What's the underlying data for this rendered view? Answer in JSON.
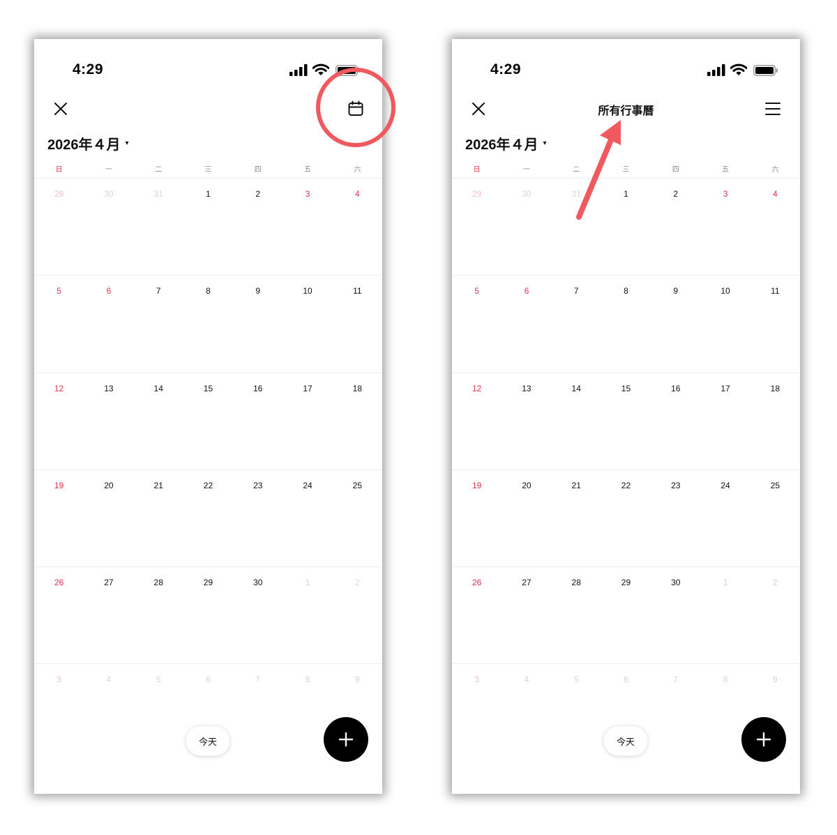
{
  "colors": {
    "accent_red": "#e0334f",
    "annotation_red": "#f05a5f",
    "fab": "#000000",
    "muted": "#d6d6d6"
  },
  "status": {
    "time": "4:29"
  },
  "header": {
    "title_right": "所有行事曆"
  },
  "month": {
    "label": "2026年４月",
    "caret": "▾"
  },
  "weekdays": [
    "日",
    "一",
    "二",
    "三",
    "四",
    "五",
    "六"
  ],
  "weeks": [
    [
      {
        "d": "29",
        "muted": true,
        "red": true
      },
      {
        "d": "30",
        "muted": true
      },
      {
        "d": "31",
        "muted": true
      },
      {
        "d": "1"
      },
      {
        "d": "2"
      },
      {
        "d": "3",
        "red": true
      },
      {
        "d": "4",
        "red": true
      }
    ],
    [
      {
        "d": "5",
        "red": true
      },
      {
        "d": "6",
        "red": true
      },
      {
        "d": "7"
      },
      {
        "d": "8"
      },
      {
        "d": "9"
      },
      {
        "d": "10"
      },
      {
        "d": "11"
      }
    ],
    [
      {
        "d": "12",
        "red": true
      },
      {
        "d": "13"
      },
      {
        "d": "14"
      },
      {
        "d": "15"
      },
      {
        "d": "16"
      },
      {
        "d": "17"
      },
      {
        "d": "18"
      }
    ],
    [
      {
        "d": "19",
        "red": true
      },
      {
        "d": "20"
      },
      {
        "d": "21"
      },
      {
        "d": "22"
      },
      {
        "d": "23"
      },
      {
        "d": "24"
      },
      {
        "d": "25"
      }
    ],
    [
      {
        "d": "26",
        "red": true
      },
      {
        "d": "27"
      },
      {
        "d": "28"
      },
      {
        "d": "29"
      },
      {
        "d": "30"
      },
      {
        "d": "1",
        "muted": true,
        "red": true
      },
      {
        "d": "2",
        "muted": true
      }
    ],
    [
      {
        "d": "3",
        "muted": true,
        "red": true
      },
      {
        "d": "4",
        "muted": true
      },
      {
        "d": "5",
        "muted": true
      },
      {
        "d": "6",
        "muted": true
      },
      {
        "d": "7",
        "muted": true
      },
      {
        "d": "8",
        "muted": true
      },
      {
        "d": "9",
        "muted": true
      }
    ]
  ],
  "buttons": {
    "today": "今天"
  },
  "icons": {
    "close": "close-icon",
    "calendar": "calendar-icon",
    "menu": "menu-icon",
    "add": "plus-icon",
    "signal": "cellular-signal-icon",
    "wifi": "wifi-icon",
    "battery": "battery-icon"
  }
}
